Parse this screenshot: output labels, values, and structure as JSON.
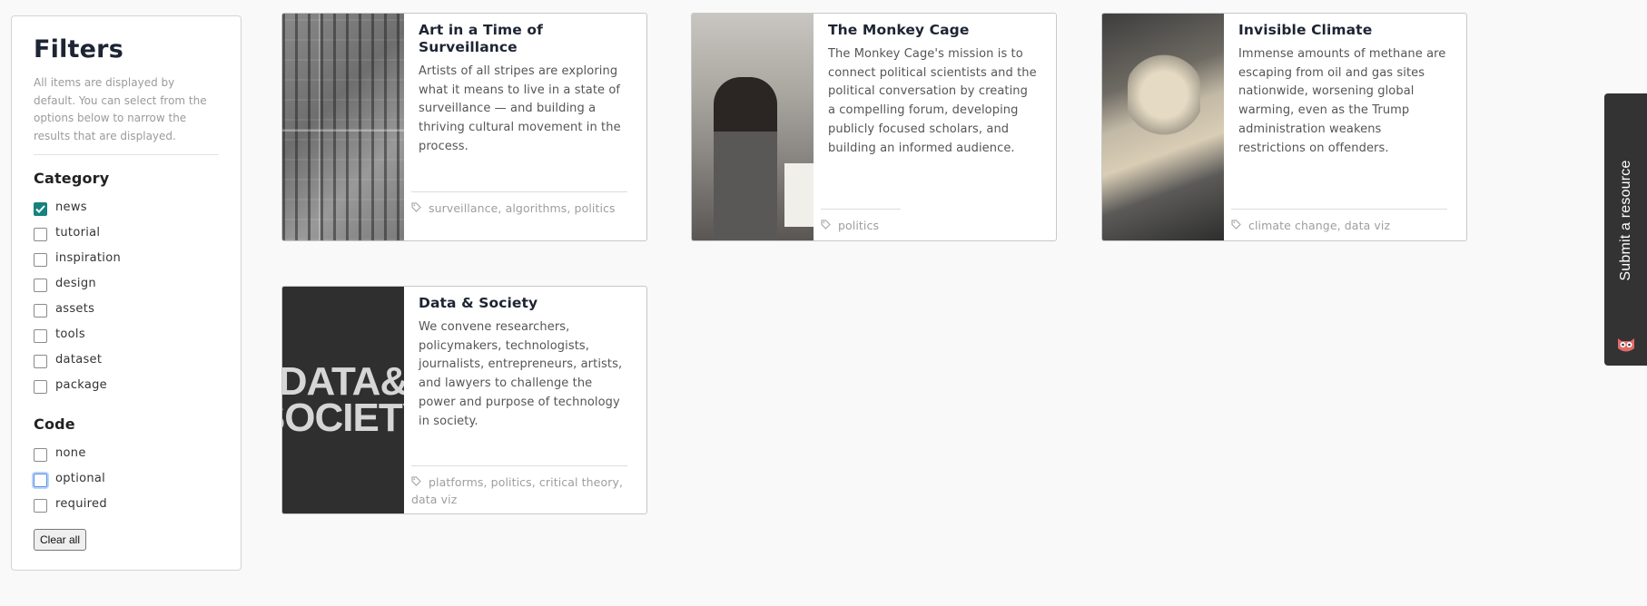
{
  "filters": {
    "title": "Filters",
    "description": "All items are displayed by default. You can select from the options below to narrow the results that are displayed.",
    "category": {
      "heading": "Category",
      "options": [
        {
          "label": "news",
          "checked": true
        },
        {
          "label": "tutorial",
          "checked": false
        },
        {
          "label": "inspiration",
          "checked": false
        },
        {
          "label": "design",
          "checked": false
        },
        {
          "label": "assets",
          "checked": false
        },
        {
          "label": "tools",
          "checked": false
        },
        {
          "label": "dataset",
          "checked": false
        },
        {
          "label": "package",
          "checked": false
        }
      ]
    },
    "code": {
      "heading": "Code",
      "options": [
        {
          "label": "none",
          "checked": false
        },
        {
          "label": "optional",
          "checked": false,
          "focused": true
        },
        {
          "label": "required",
          "checked": false
        }
      ]
    },
    "clear_label": "Clear all"
  },
  "cards": [
    {
      "title": "Art in a Time of Surveillance",
      "summary": "Artists of all stripes are exploring what it means to live in a state of surveillance — and building a thriving cultural movement in the process.",
      "tags": "surveillance, algorithms, politics",
      "thumbnail": "surveillance-crowd-photo"
    },
    {
      "title": "The Monkey Cage",
      "summary": "The Monkey Cage's mission is to connect political scientists and the political conversation by creating a compelling forum, developing publicly focused scholars, and building an informed audience.",
      "tags": "politics",
      "thumbnail": "protester-photo"
    },
    {
      "title": "Invisible Climate",
      "summary": "Immense amounts of methane are escaping from oil and gas sites nationwide, worsening global warming, even as the Trump administration weakens restrictions on offenders.",
      "tags": "climate change, data viz",
      "thumbnail": "airplane-cockpit-photo"
    },
    {
      "title": "Data & Society",
      "summary": "We convene researchers, policymakers, technologists, journalists, entrepreneurs, artists, and lawyers to challenge the power and purpose of technology in society.",
      "tags": "platforms, politics, critical theory, data viz",
      "thumbnail": "data-society-logo",
      "logo_line1": "DATA&",
      "logo_line2": "SOCIETY"
    }
  ],
  "submit_tab": {
    "label": "Submit a resource",
    "icon": "owl-icon"
  },
  "colors": {
    "accent": "#17827d",
    "submit_bg": "#333333",
    "page_bg": "#f8f9f8"
  }
}
